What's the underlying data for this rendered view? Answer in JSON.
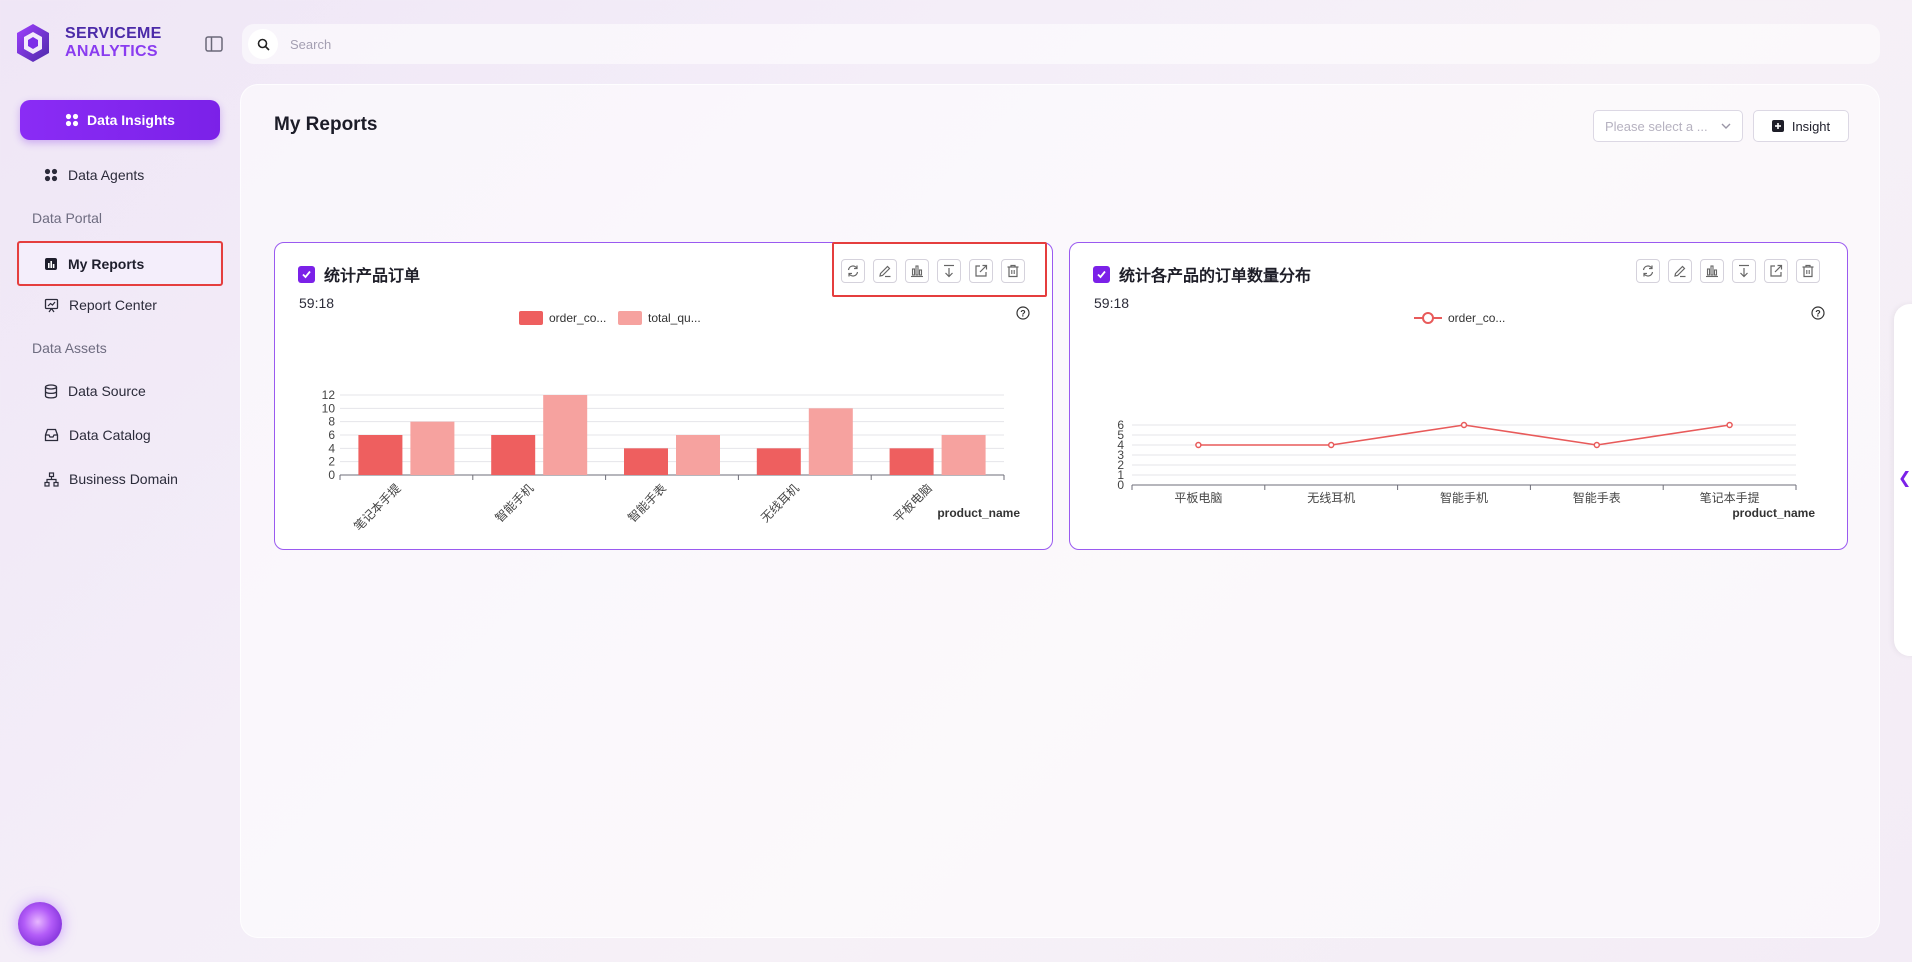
{
  "app": {
    "logo_line1": "SERVICEME",
    "logo_line2": "ANALYTICS"
  },
  "search": {
    "placeholder": "Search"
  },
  "sidebar": {
    "primary_button": "Data Insights",
    "items": [
      {
        "label": "Data Agents"
      },
      {
        "section": "Data Portal"
      },
      {
        "label": "My Reports"
      },
      {
        "label": "Report Center"
      },
      {
        "section": "Data Assets"
      },
      {
        "label": "Data Source"
      },
      {
        "label": "Data Catalog"
      },
      {
        "label": "Business Domain"
      }
    ]
  },
  "header": {
    "title": "My Reports",
    "select_placeholder": "Please select a ...",
    "insight_label": "Insight"
  },
  "cards": [
    {
      "title": "统计产品订单",
      "time": "59:18",
      "x_axis_name": "product_name"
    },
    {
      "title": "统计各产品的订单数量分布",
      "time": "59:18",
      "x_axis_name": "product_name"
    }
  ],
  "colors": {
    "accent": "#7b21e8",
    "bar1": "#ee5f5f",
    "bar2": "#f6a29f",
    "line": "#e85a5a",
    "highlight": "#e53e3e"
  },
  "chart_data": [
    {
      "type": "bar",
      "title": "统计产品订单",
      "categories": [
        "笔记本手提",
        "智能手机",
        "智能手表",
        "无线耳机",
        "平板电脑"
      ],
      "series": [
        {
          "name": "order_co...",
          "values": [
            6,
            6,
            4,
            4,
            4
          ]
        },
        {
          "name": "total_qu...",
          "values": [
            8,
            12,
            6,
            10,
            6
          ]
        }
      ],
      "xlabel": "product_name",
      "ylim": [
        0,
        12
      ],
      "yticks": [
        0,
        2,
        4,
        6,
        8,
        10,
        12
      ],
      "legend": "top-center",
      "grid": true
    },
    {
      "type": "line",
      "title": "统计各产品的订单数量分布",
      "categories": [
        "平板电脑",
        "无线耳机",
        "智能手机",
        "智能手表",
        "笔记本手提"
      ],
      "series": [
        {
          "name": "order_co...",
          "values": [
            4,
            4,
            6,
            4,
            6
          ]
        }
      ],
      "xlabel": "product_name",
      "ylim": [
        0,
        6
      ],
      "yticks": [
        0,
        1,
        2,
        3,
        4,
        5,
        6
      ],
      "legend": "top-center",
      "grid": true
    }
  ]
}
